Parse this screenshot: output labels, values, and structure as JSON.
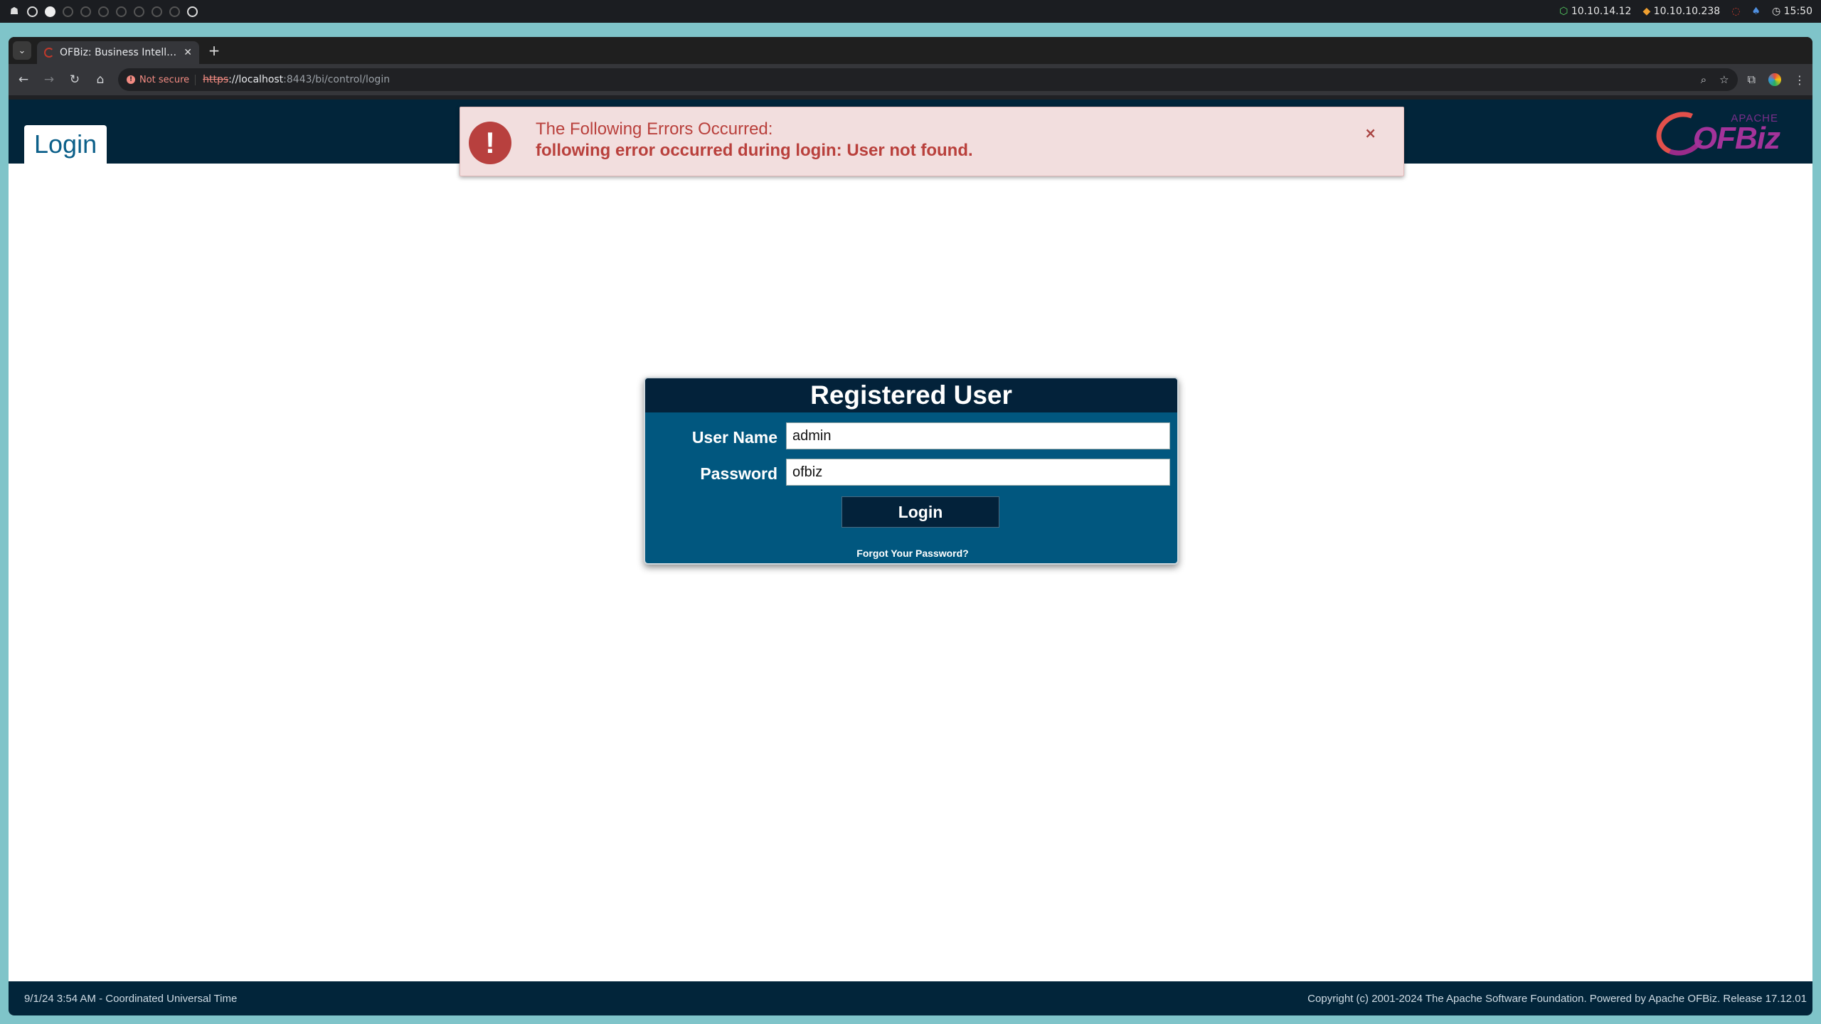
{
  "system_bar": {
    "ip1": "10.10.14.12",
    "ip2": "10.10.10.238",
    "clock": "15:50"
  },
  "browser": {
    "tab_title": "OFBiz: Business Intelligen",
    "security_chip": "Not secure",
    "url_scheme": "https",
    "url_host": "://localhost",
    "url_path": ":8443/bi/control/login"
  },
  "header": {
    "page_tab": "Login",
    "logo_apache": "APACHE",
    "logo_ofbiz": "OFBiz"
  },
  "alert": {
    "title": "The Following Errors Occurred:",
    "message": "following error occurred during login: User not found.",
    "close": "×",
    "icon": "!"
  },
  "login_form": {
    "title": "Registered User",
    "username_label": "User Name",
    "username_value": "admin",
    "password_label": "Password",
    "password_value": "ofbiz",
    "submit_label": "Login",
    "forgot_label": "Forgot Your Password?"
  },
  "footer": {
    "left": "9/1/24 3:54 AM - Coordinated Universal Time",
    "right": "Copyright (c) 2001-2024 The Apache Software Foundation. Powered by Apache OFBiz. Release 17.12.01"
  },
  "colors": {
    "header_bg": "#02253a",
    "card_bg": "#01577f",
    "alert_bg": "#f2dede",
    "alert_text": "#b9403c"
  }
}
